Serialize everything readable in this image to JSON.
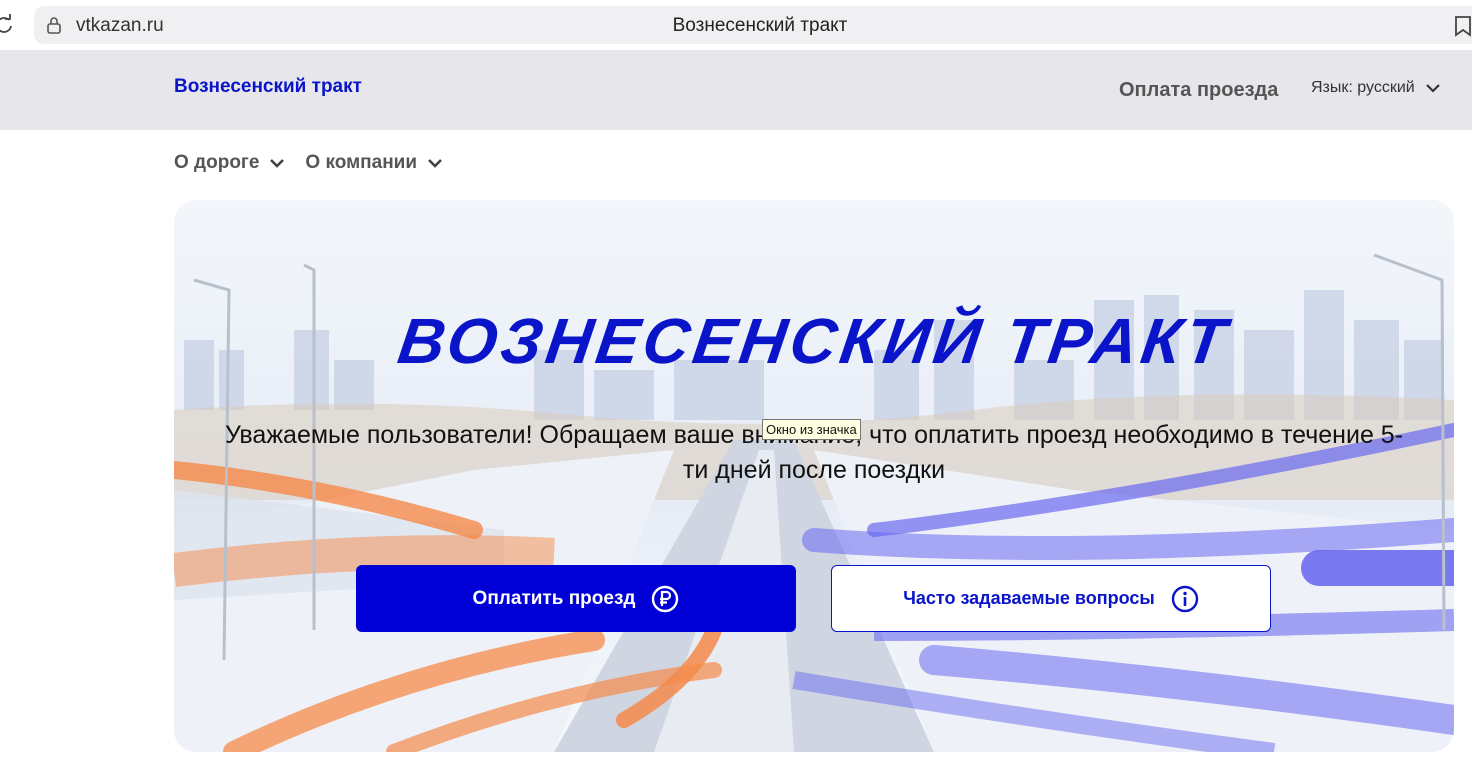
{
  "browser": {
    "url": "vtkazan.ru",
    "tab_title": "Вознесенский тракт"
  },
  "header": {
    "logo": "Вознесенский тракт",
    "pay_link": "Оплата проезда",
    "language": "Язык: русский"
  },
  "nav": {
    "items": [
      {
        "label": "О дороге"
      },
      {
        "label": "О компании"
      }
    ]
  },
  "hero": {
    "title": "ВОЗНЕСЕНСКИЙ ТРАКТ",
    "text": "Уважаемые пользователи! Обращаем ваше внимание, что оплатить проезд необходимо в течение 5-ти дней после поездки",
    "pay_button": "Оплатить проезд",
    "faq_button": "Часто задаваемые вопросы"
  },
  "tooltip": "Окно из значка",
  "colors": {
    "brand": "#0a14c8",
    "button": "#0000d6",
    "accent_orange": "#f58a4a",
    "accent_violet": "#6060ee"
  },
  "icons": [
    "reload-icon",
    "lock-icon",
    "bookmark-icon",
    "chevron-down-icon",
    "ruble-icon",
    "info-icon"
  ]
}
